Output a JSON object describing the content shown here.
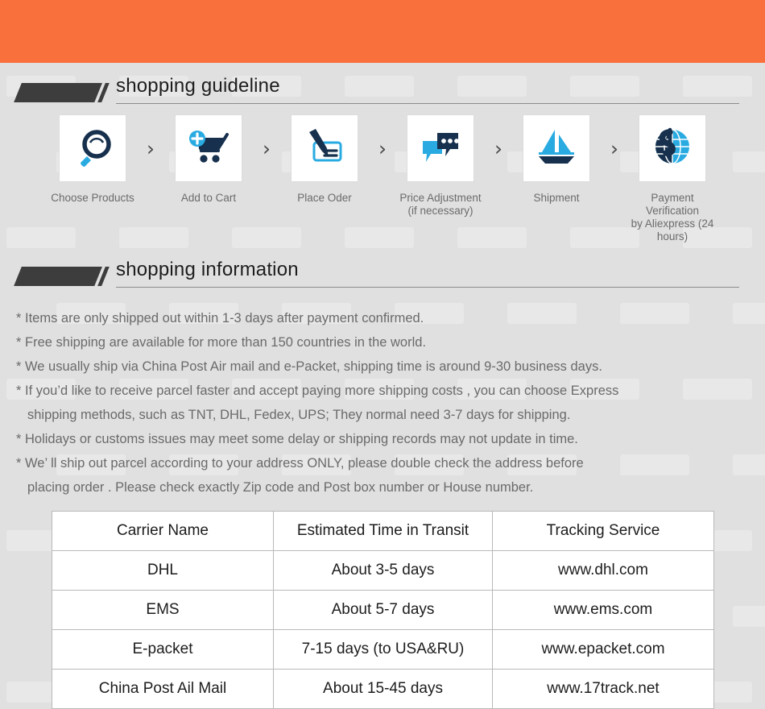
{
  "theme": {
    "banner_color": "#fa703c",
    "page_background": "#e0e0e0",
    "icon_dark": "#1c3d5e",
    "icon_light": "#29abe2",
    "tag_color": "#3d3d3d"
  },
  "banner": {
    "label": ""
  },
  "guideline": {
    "title": "shopping guideline",
    "chevron": "›",
    "steps": [
      {
        "icon": "magnifier-icon",
        "label": "Choose Products"
      },
      {
        "icon": "add-to-cart-icon",
        "label": "Add to Cart"
      },
      {
        "icon": "pen-check-icon",
        "label": "Place Oder"
      },
      {
        "icon": "chat-bubbles-icon",
        "label": "Price Adjustment\n(if necessary)"
      },
      {
        "icon": "sailboat-icon",
        "label": "Shipment"
      },
      {
        "icon": "dollar-globe-icon",
        "label": "Payment Verification\nby  Aliexpress (24 hours)"
      }
    ]
  },
  "information": {
    "title": "shopping information",
    "lines": [
      {
        "text": "* Items are only shipped out within 1-3 days after payment confirmed.",
        "indent": false
      },
      {
        "text": "* Free shipping are available for more than 150 countries in the world.",
        "indent": false
      },
      {
        "text": "* We usually ship via China Post Air mail and e-Packet, shipping time is around 9-30 business days.",
        "indent": false
      },
      {
        "text": "* If you’d like to receive parcel faster and accept paying more shipping costs , you can choose Express",
        "indent": false
      },
      {
        "text": "shipping methods, such as TNT, DHL, Fedex, UPS; They normal need 3-7 days for shipping.",
        "indent": true
      },
      {
        "text": "* Holidays or customs issues may meet some delay or shipping records may not update in time.",
        "indent": false
      },
      {
        "text": "* We’ ll ship out parcel according to your address ONLY, please double check the address before",
        "indent": false
      },
      {
        "text": "placing order . Please check exactly Zip code and Post box number or House number.",
        "indent": true
      }
    ]
  },
  "carrier_table": {
    "headers": [
      "Carrier Name",
      "Estimated Time in Transit",
      "Tracking Service"
    ],
    "rows": [
      [
        "DHL",
        "About 3-5 days",
        "www.dhl.com"
      ],
      [
        "EMS",
        "About 5-7 days",
        "www.ems.com"
      ],
      [
        "E-packet",
        "7-15 days (to USA&RU)",
        "www.epacket.com"
      ],
      [
        "China Post Ail Mail",
        "About 15-45 days",
        "www.17track.net"
      ]
    ]
  }
}
